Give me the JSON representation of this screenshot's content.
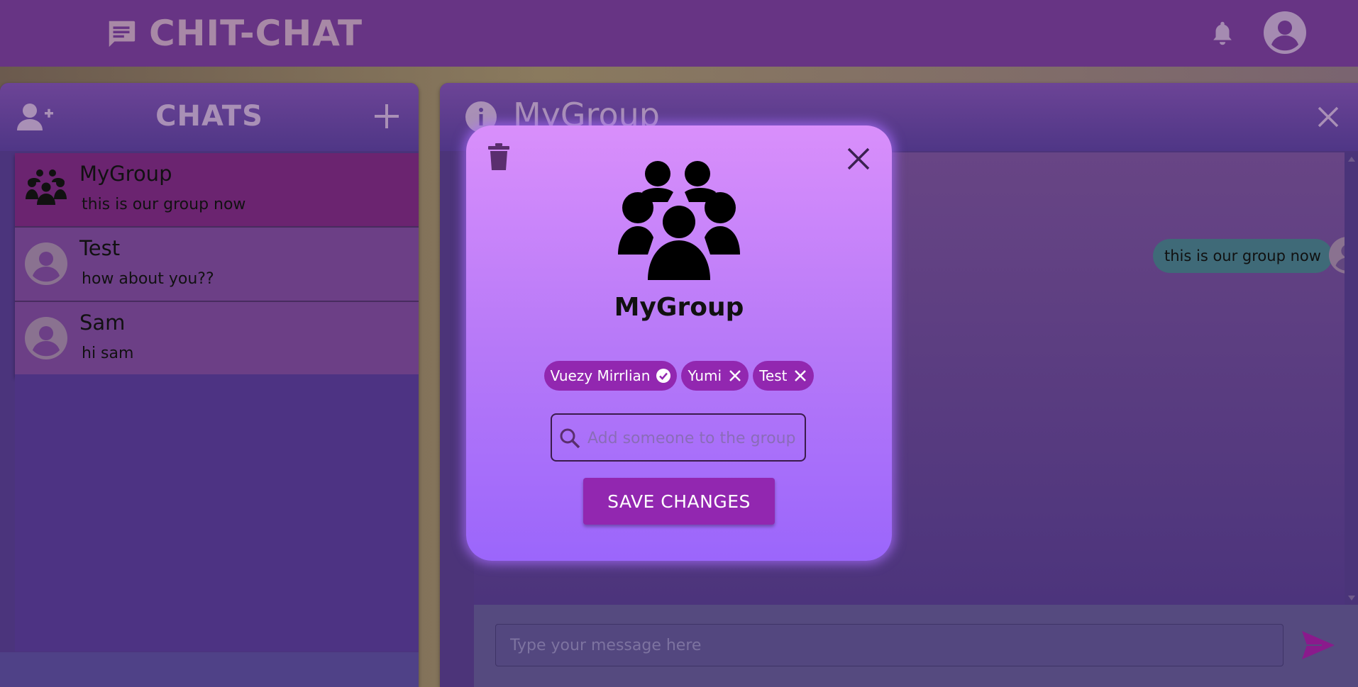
{
  "app": {
    "title": "CHIT-CHAT"
  },
  "colors": {
    "header": "#673484",
    "panel": "#4b347c",
    "active_chat": "#6b2470",
    "chip": "#9227b0",
    "save_button": "#9227b0",
    "message_bubble": "#3f6a78",
    "send_icon": "#8a1a8c"
  },
  "header": {
    "icons": [
      "chat-icon",
      "bell-icon",
      "user-avatar-icon"
    ]
  },
  "sidebar": {
    "title": "CHATS",
    "icons": [
      "add-user-icon",
      "plus-icon"
    ],
    "chats": [
      {
        "name": "MyGroup",
        "preview": "this is our group now",
        "active": true,
        "avatar": "group-icon"
      },
      {
        "name": "Test",
        "preview": "how about you??",
        "active": false,
        "avatar": "user-avatar-icon"
      },
      {
        "name": "Sam",
        "preview": "hi sam",
        "active": false,
        "avatar": "user-avatar-icon"
      }
    ]
  },
  "conversation": {
    "title": "MyGroup",
    "messages": [
      {
        "text": "this is our group now",
        "from": "self"
      }
    ],
    "composer": {
      "placeholder": "Type your message here"
    }
  },
  "modal": {
    "group_name": "MyGroup",
    "members": [
      {
        "name": "Vuezy Mirrlian",
        "action": "check-circle-icon"
      },
      {
        "name": "Yumi",
        "action": "remove-icon"
      },
      {
        "name": "Test",
        "action": "remove-icon"
      }
    ],
    "search_placeholder": "Add someone to the group",
    "save_label": "SAVE CHANGES"
  }
}
